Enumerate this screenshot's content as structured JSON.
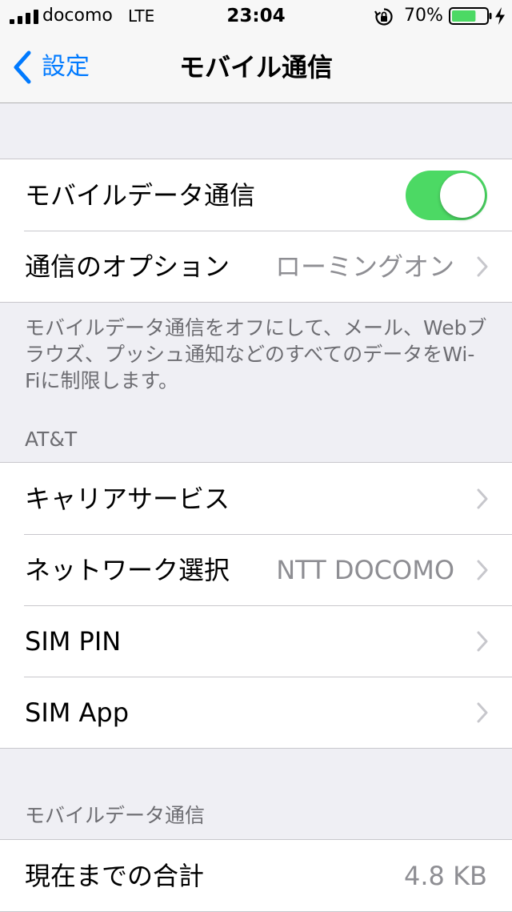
{
  "status_bar": {
    "carrier": "docomo",
    "network": "LTE",
    "time": "23:04",
    "battery_percent": "70%",
    "battery_level": 0.7,
    "icons": [
      "signal-icon",
      "orientation-lock-icon",
      "battery-icon",
      "charging-bolt-icon"
    ]
  },
  "nav": {
    "back_label": "設定",
    "title": "モバイル通信"
  },
  "main_group": {
    "mobile_data_label": "モバイルデータ通信",
    "mobile_data_on": true,
    "options_label": "通信のオプション",
    "options_value": "ローミングオン"
  },
  "main_footer": "モバイルデータ通信をオフにして、メール、Webブラウズ、プッシュ通知などのすべてのデータをWi-Fiに制限します。",
  "carrier_section": {
    "header": "AT&T",
    "items": [
      {
        "label": "キャリアサービス",
        "value": ""
      },
      {
        "label": "ネットワーク選択",
        "value": "NTT DOCOMO"
      },
      {
        "label": "SIM PIN",
        "value": ""
      },
      {
        "label": "SIM App",
        "value": ""
      }
    ]
  },
  "usage_section": {
    "header": "モバイルデータ通信",
    "items": [
      {
        "label": "現在までの合計",
        "value": "4.8 KB"
      }
    ]
  },
  "colors": {
    "accent": "#007aff",
    "toggle_on": "#4cd964",
    "battery": "#4cd964",
    "secondary_text": "#8e8e93",
    "group_background": "#efeff4"
  }
}
